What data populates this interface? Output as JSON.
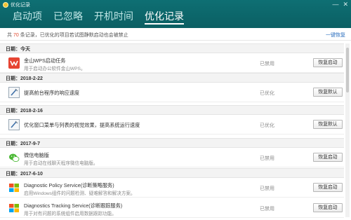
{
  "window": {
    "title": "优化记录",
    "min_btn": "—",
    "close_btn": "✕"
  },
  "tabs": [
    {
      "label": "启动项"
    },
    {
      "label": "已忽略"
    },
    {
      "label": "开机时间"
    },
    {
      "label": "优化记录",
      "active": true
    }
  ],
  "summary": {
    "prefix": "共",
    "count": "70",
    "suffix": "条记录，已优化的项目若试图静默启动也会被禁止",
    "restore_all": "一键恢复"
  },
  "groups": [
    {
      "date": "日期：今天",
      "items": [
        {
          "icon": "wps-icon",
          "title": "金山WPS启动任务",
          "desc": "用于启动办公软件金山WPS。",
          "status": "已禁用",
          "action": "恢复启动"
        }
      ]
    },
    {
      "date": "日期：2018-2-22",
      "items": [
        {
          "icon": "tool-icon",
          "title": "提高前台程序的响应速度",
          "desc": "",
          "status": "已优化",
          "action": "恢复默认"
        }
      ]
    },
    {
      "date": "日期：2018-2-16",
      "items": [
        {
          "icon": "tool-icon",
          "title": "优化窗口菜单与列表的视觉效果，提高系统运行速度",
          "desc": "",
          "status": "已优化",
          "action": "恢复默认"
        }
      ]
    },
    {
      "date": "日期：2017-9-7",
      "items": [
        {
          "icon": "wechat-icon",
          "title": "微信电脑版",
          "desc": "用于启动在线聊天程序微信电脑版。",
          "status": "已禁用",
          "action": "恢复启动"
        }
      ]
    },
    {
      "date": "日期：2017-6-10",
      "items": [
        {
          "icon": "windows-icon",
          "title": "Diagnostic Policy Service(诊断策略服务)",
          "desc": "启用Windows组件的问题检测、疑难解答和解决方案。",
          "status": "已禁用",
          "action": "恢复启动"
        },
        {
          "icon": "windows-icon",
          "title": "Diagnostics Tracking Service(诊断跟踪服务)",
          "desc": "用于对有问题的系统组件启用数据跟踪功能。",
          "status": "已禁用",
          "action": "恢复启动"
        }
      ]
    }
  ]
}
